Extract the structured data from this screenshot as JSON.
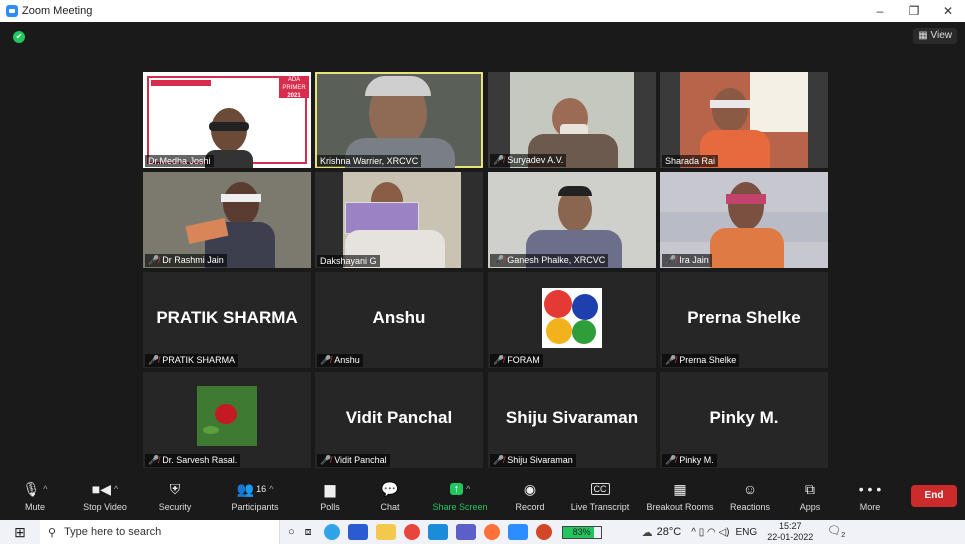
{
  "window": {
    "title": "Zoom Meeting",
    "minimize": "–",
    "restore": "❐",
    "close": "✕"
  },
  "view_label": "View",
  "tiles": [
    {
      "name": "Dr.Medha Joshi",
      "muted": false
    },
    {
      "name": "Krishna Warrier, XRCVC",
      "muted": false
    },
    {
      "name": "Suryadev A.V.",
      "muted": true
    },
    {
      "name": "Sharada Rai",
      "muted": false
    },
    {
      "name": "Dr Rashmi Jain",
      "muted": true
    },
    {
      "name": "Dakshayani G",
      "muted": false
    },
    {
      "name": "Ganesh Phalke, XRCVC",
      "muted": true
    },
    {
      "name": "Ira Jain",
      "muted": true
    },
    {
      "name": "PRATIK SHARMA",
      "muted": true,
      "big": "PRATIK SHARMA"
    },
    {
      "name": "Anshu",
      "muted": true,
      "big": "Anshu"
    },
    {
      "name": "FORAM",
      "muted": true
    },
    {
      "name": "Prerna Shelke",
      "muted": true,
      "big": "Prerna Shelke"
    },
    {
      "name": "Dr. Sarvesh Rasal.",
      "muted": true
    },
    {
      "name": "Vidit Panchal",
      "muted": true,
      "big": "Vidit Panchal"
    },
    {
      "name": "Shiju Sivaraman",
      "muted": true,
      "big": "Shiju Sivaraman"
    },
    {
      "name": "Pinky M.",
      "muted": true,
      "big": "Pinky M."
    }
  ],
  "poster": {
    "badge": "ADA PRIMER",
    "year": "2021"
  },
  "toolbar": {
    "mute": "Mute",
    "stop_video": "Stop Video",
    "security": "Security",
    "participants": "Participants",
    "participant_count": "16",
    "polls": "Polls",
    "chat": "Chat",
    "share_screen": "Share Screen",
    "record": "Record",
    "live_transcript": "Live Transcript",
    "breakout_rooms": "Breakout Rooms",
    "reactions": "Reactions",
    "apps": "Apps",
    "more": "More",
    "end": "End",
    "cc": "CC",
    "more_dots": "• • •"
  },
  "taskbar": {
    "search_placeholder": "Type here to search",
    "battery": "83%",
    "temperature": "28°C",
    "language": "ENG",
    "time": "15:27",
    "date": "22-01-2022",
    "notifications": "2"
  },
  "colors": {
    "accent": "#2d8cff",
    "end": "#cc2b2b",
    "active_speaker": "#e6e37d",
    "green": "#23c55e"
  }
}
